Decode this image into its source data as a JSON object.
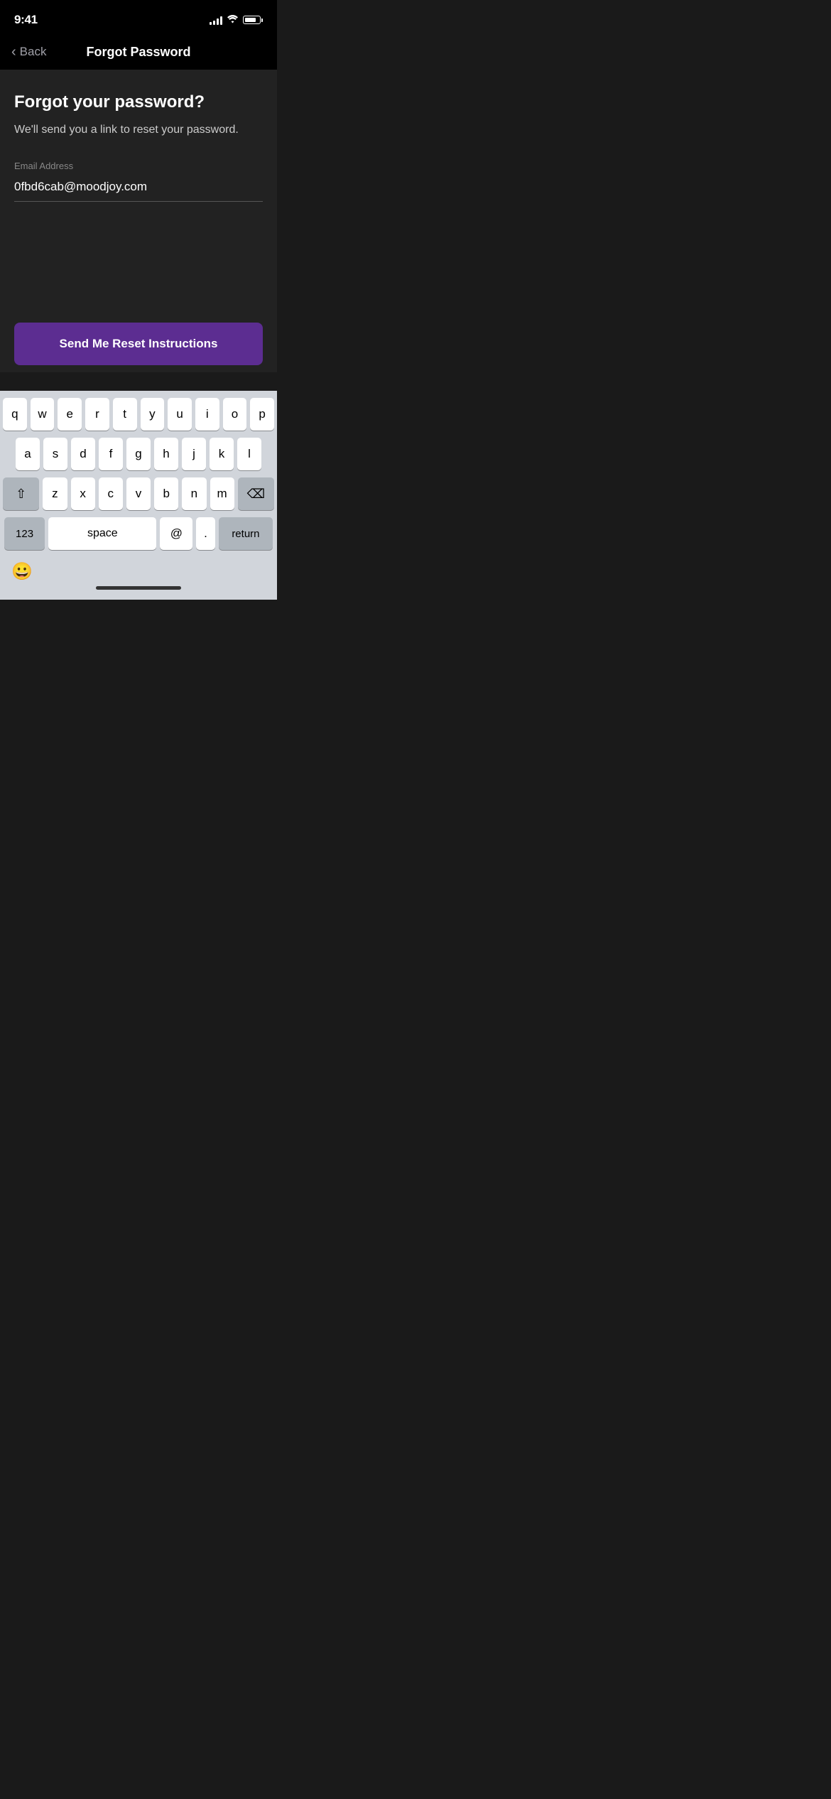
{
  "statusBar": {
    "time": "9:41"
  },
  "navBar": {
    "backLabel": "Back",
    "title": "Forgot Password"
  },
  "main": {
    "heading": "Forgot your password?",
    "description": "We'll send you a link to reset your password.",
    "emailLabel": "Email Address",
    "emailValue": "0fbd6cab@moodjoy.com",
    "emailPlaceholder": "Email Address"
  },
  "actions": {
    "sendButton": "Send Me Reset Instructions"
  },
  "keyboard": {
    "row1": [
      "q",
      "w",
      "e",
      "r",
      "t",
      "y",
      "u",
      "i",
      "o",
      "p"
    ],
    "row2": [
      "a",
      "s",
      "d",
      "f",
      "g",
      "h",
      "j",
      "k",
      "l"
    ],
    "row3": [
      "z",
      "x",
      "c",
      "v",
      "b",
      "n",
      "m"
    ],
    "bottomKeys": {
      "numbers": "123",
      "space": "space",
      "at": "@",
      "dot": ".",
      "return": "return"
    }
  }
}
